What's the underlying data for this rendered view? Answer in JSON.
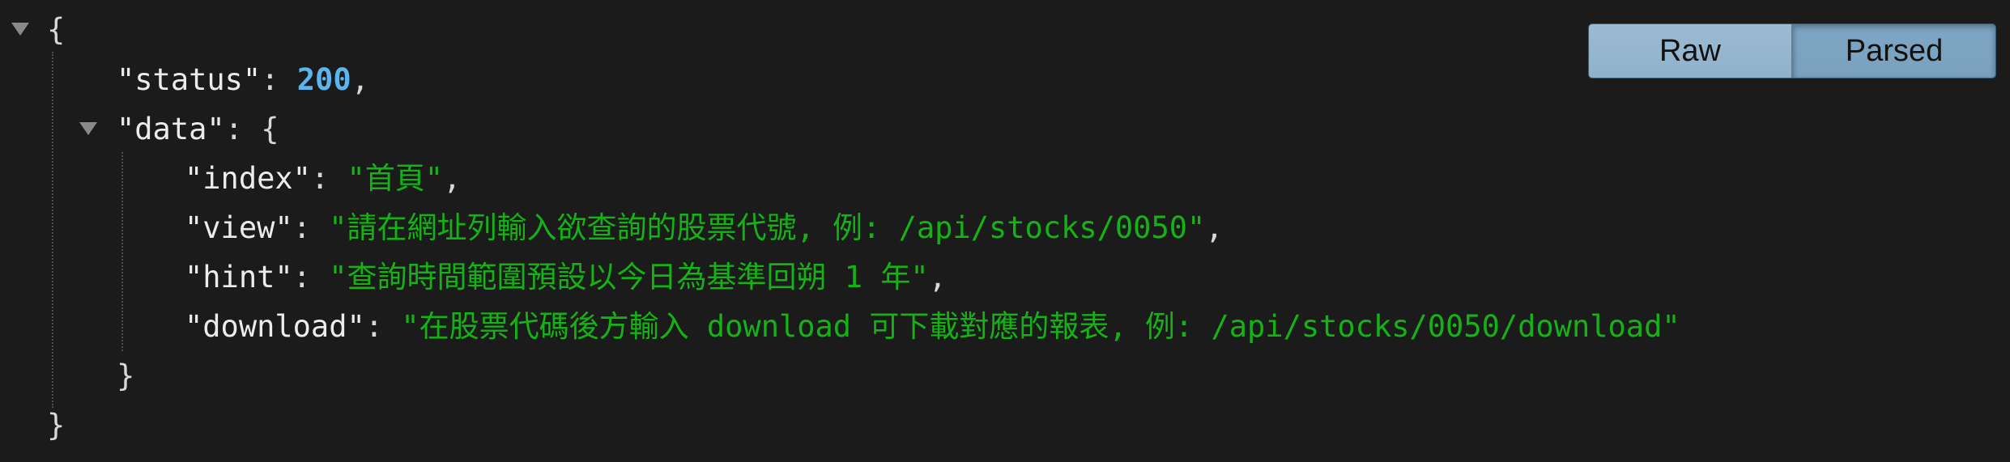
{
  "json_view": {
    "open_brace": "{",
    "close_brace": "}",
    "status": {
      "key": "\"status\"",
      "value": "200"
    },
    "data": {
      "key": "\"data\"",
      "open_brace": "{",
      "close_brace": "}",
      "entries": [
        {
          "key": "\"index\"",
          "value": "\"首頁\""
        },
        {
          "key": "\"view\"",
          "value": "\"請在網址列輸入欲查詢的股票代號, 例: /api/stocks/0050\""
        },
        {
          "key": "\"hint\"",
          "value": "\"查詢時間範圍預設以今日為基準回朔 1 年\""
        },
        {
          "key": "\"download\"",
          "value": "\"在股票代碼後方輸入 download 可下載對應的報表, 例: /api/stocks/0050/download\""
        }
      ]
    }
  },
  "view_toggle": {
    "raw_label": "Raw",
    "parsed_label": "Parsed",
    "active": "Parsed"
  },
  "colors": {
    "background": "#1b1b1b",
    "key": "#ececec",
    "number": "#5cb6ee",
    "string": "#15b215",
    "button": "#8fb1ca"
  }
}
